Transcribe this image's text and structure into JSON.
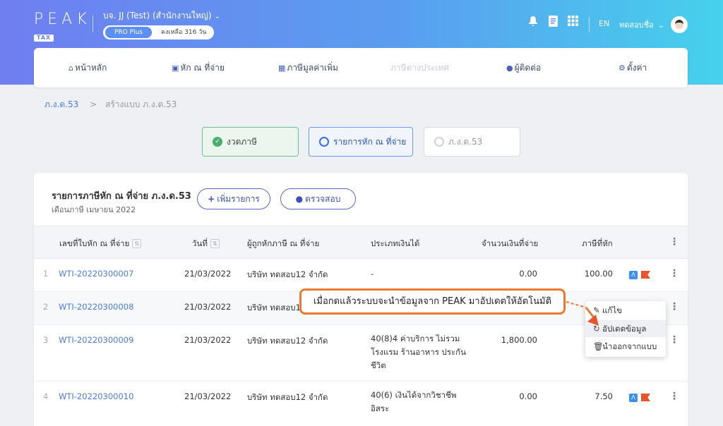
{
  "header": {
    "logo": "PEAK",
    "logo_sub": "TAX",
    "company": "บจ. JJ (Test) (สำนักงานใหญ่)",
    "plan": "PRO Plus",
    "remaining": "คงเหลือ 316 วัน",
    "lang": "EN",
    "user": "ทดสอบชื่อ"
  },
  "nav": {
    "items": [
      {
        "label": "หน้าหลัก",
        "icon": "home-icon"
      },
      {
        "label": "หัก ณ ที่จ่าย",
        "icon": "wallet-icon"
      },
      {
        "label": "ภาษีมูลค่าเพิ่ม",
        "icon": "receipt-icon"
      },
      {
        "label": "ภาษีต่างประเทศ",
        "icon": ""
      },
      {
        "label": "ผู้ติดต่อ",
        "icon": "person-icon"
      },
      {
        "label": "ตั้งค่า",
        "icon": "gear-icon"
      }
    ]
  },
  "breadcrumb": {
    "root": "ภ.ง.ด.53",
    "sep": ">",
    "current": "สร้างแบบ ภ.ง.ด.53"
  },
  "steps": [
    {
      "label": "งวดภาษี",
      "state": "done"
    },
    {
      "label": "รายการหัก ณ ที่จ่าย",
      "state": "active"
    },
    {
      "label": "ภ.ง.ด.53",
      "state": "todo"
    }
  ],
  "card": {
    "title": "รายการภาษีหัก ณ ที่จ่าย ภ.ง.ด.53",
    "subtitle": "เดือนภาษี เมษายน 2022",
    "add_button": "เพิ่มรายการ",
    "check_button": "ตรวจสอบ"
  },
  "table": {
    "columns": [
      "เลขที่ใบหัก ณ ที่จ่าย",
      "วันที่",
      "ผู้ถูกหักภาษี ณ ที่จ่าย",
      "ประเภทเงินได้",
      "จำนวนเงินที่จ่าย",
      "ภาษีที่หัก"
    ],
    "rows": [
      {
        "no": "1",
        "doc": "WTI-20220300007",
        "date": "21/03/2022",
        "payee": "บริษัท ทดสอบ12 จำกัด",
        "type": "-",
        "amount": "0.00",
        "tax": "100.00"
      },
      {
        "no": "2",
        "doc": "WTI-20220300008",
        "date": "21/03/2022",
        "payee": "บริษัท ทดสอบ1",
        "type": "",
        "amount": "",
        "tax": ""
      },
      {
        "no": "3",
        "doc": "WTI-20220300009",
        "date": "21/03/2022",
        "payee": "บริษัท ทดสอบ12 จำกัด",
        "type": "40(8)4 ค่าบริการ ไม่รวมโรงแรม ร้านอาหาร ประกันชีวิต",
        "amount": "1,800.00",
        "tax": ""
      },
      {
        "no": "4",
        "doc": "WTI-20220300010",
        "date": "21/03/2022",
        "payee": "บริษัท ทดสอบ12 จำกัด",
        "type": "40(6) เงินได้จากวิชาชีพอิสระ",
        "amount": "0.00",
        "tax": "7.50"
      }
    ]
  },
  "context_menu": [
    "แก้ไข",
    "อัปเดตข้อมูล",
    "นำออกจากแบบ"
  ],
  "callout": "เมื่อกดแล้วระบบจะนำข้อมูลจาก PEAK มาอัปเดตให้อัตโนมัติ",
  "colors": {
    "accent": "#ec7a2e",
    "primary": "#3b6fe0",
    "success": "#4caf6e"
  }
}
